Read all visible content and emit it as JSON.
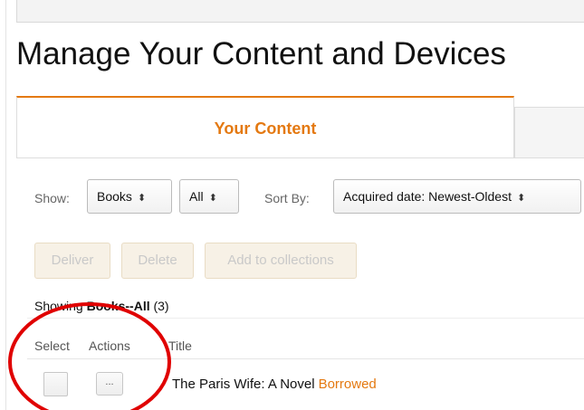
{
  "header": {
    "title": "Manage Your Content and Devices"
  },
  "tabs": [
    {
      "label": "Your Content",
      "active": true
    },
    {
      "label": "",
      "active": false
    }
  ],
  "toolbar": {
    "show_label": "Show:",
    "type_select": "Books",
    "filter_select": "All",
    "sort_label": "Sort By:",
    "sort_select": "Acquired date: Newest-Oldest"
  },
  "bulk_actions": {
    "deliver": "Deliver",
    "delete": "Delete",
    "add_to_collections": "Add to collections"
  },
  "showing": {
    "prefix": "Showing ",
    "category": "Books--All",
    "count": "(3)"
  },
  "columns": {
    "select": "Select",
    "actions": "Actions",
    "title": "Title"
  },
  "rows": [
    {
      "actions_button": "...",
      "title": "The Paris Wife: A Novel",
      "status": "Borrowed"
    }
  ],
  "colors": {
    "accent": "#e47911",
    "annotation_circle": "#e00000"
  },
  "icons": {
    "select_caret": "up-down-caret"
  }
}
